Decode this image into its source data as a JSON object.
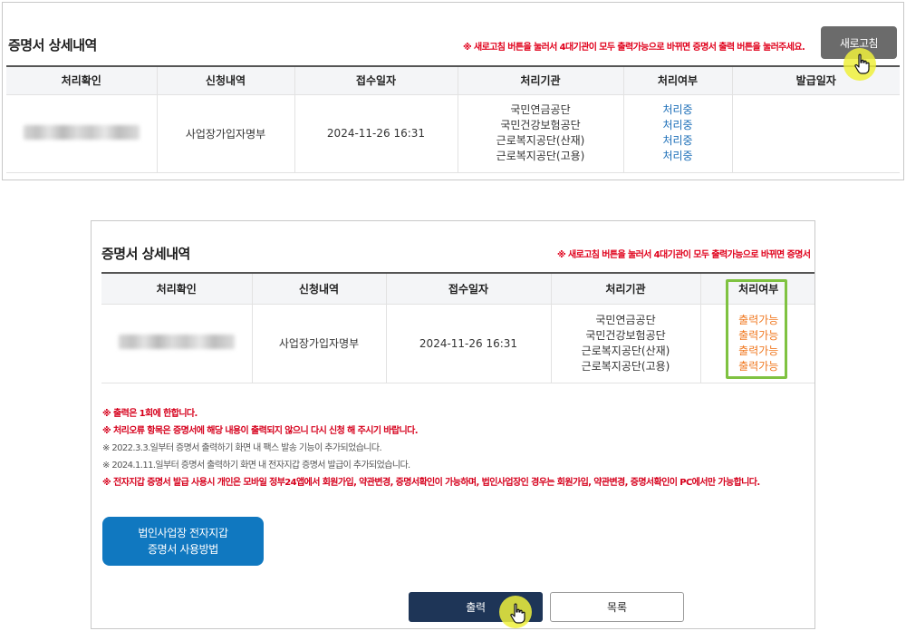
{
  "top_panel": {
    "title": "증명서 상세내역",
    "notice": "※ 새로고침 버튼을 눌러서 4대기관이 모두 출력가능으로 바뀌면 증명서 출력 버튼을 눌러주세요.",
    "refresh_button": "새로고침",
    "table": {
      "headers": [
        "처리확인",
        "신청내역",
        "접수일자",
        "처리기관",
        "처리여부",
        "발급일자"
      ],
      "row": {
        "application": "사업장가입자명부",
        "received_date": "2024-11-26 16:31",
        "agencies": [
          "국민연금공단",
          "국민건강보험공단",
          "근로복지공단(산재)",
          "근로복지공단(고용)"
        ],
        "statuses": [
          "처리중",
          "처리중",
          "처리중",
          "처리중"
        ],
        "issue_date": ""
      }
    }
  },
  "bottom_panel": {
    "title": "증명서 상세내역",
    "notice": "※ 새로고침 버튼을 눌러서 4대기관이 모두 출력가능으로 바뀌면 증명서",
    "table": {
      "headers": [
        "처리확인",
        "신청내역",
        "접수일자",
        "처리기관",
        "처리여부"
      ],
      "row": {
        "application": "사업장가입자명부",
        "received_date": "2024-11-26 16:31",
        "agencies": [
          "국민연금공단",
          "국민건강보험공단",
          "근로복지공단(산재)",
          "근로복지공단(고용)"
        ],
        "statuses": [
          "출력가능",
          "출력가능",
          "출력가능",
          "출력가능"
        ]
      }
    },
    "notes": [
      "※ 출력은 1회에 한합니다.",
      "※ 처리오류 항목은 증명서에 해당 내용이 출력되지 않으니 다시 신청 해 주시기 바랍니다.",
      "※ 2022.3.3.일부터 증명서 출력하기 화면 내 팩스 발송 기능이 추가되었습니다.",
      "※ 2024.1.11.일부터 증명서 출력하기 화면 내 전자지갑 증명서 발급이 추가되었습니다.",
      "※ 전자지갑 증명서 발급 사용시 개인은 모바일 정부24앱에서 회원가입, 약관변경, 증명서확인이 가능하며, 법인사업장인 경우는 회원가입, 약관변경, 증명서확인이 PC에서만 가능합니다."
    ],
    "guide_button": [
      "법인사업장 전자지갑",
      "증명서 사용방법"
    ],
    "print_button": "출력",
    "list_button": "목록"
  },
  "colors": {
    "processing": "#1d6fb8",
    "printable": "#f07a23",
    "notice_red": "#e0001b",
    "highlight_box": "#7fc241",
    "cursor_highlight": "#eef03c",
    "guide_button": "#1078c0",
    "print_button": "#1e3557"
  },
  "icons": [
    "hand-cursor-icon"
  ]
}
